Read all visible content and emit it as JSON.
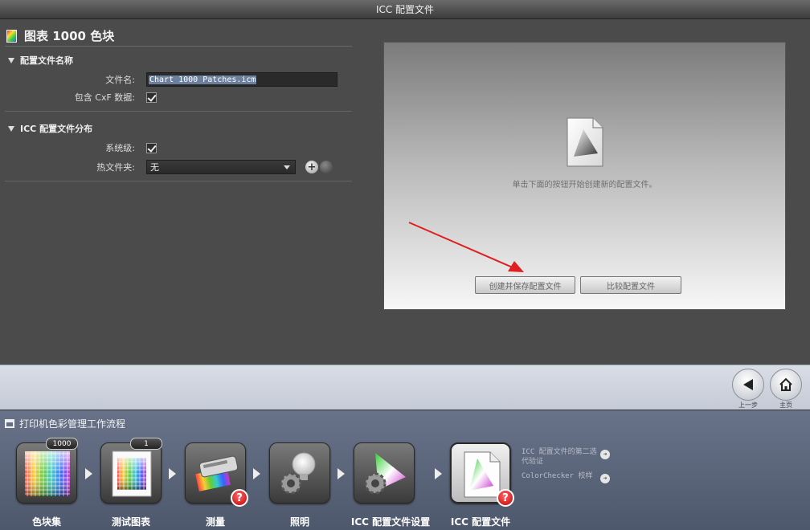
{
  "window": {
    "title": "ICC 配置文件"
  },
  "page": {
    "title": "图表 1000 色块"
  },
  "profile_name_section": {
    "heading": "配置文件名称",
    "filename_label": "文件名:",
    "filename_value": "Chart 1000 Patches.icm",
    "include_cxf_label": "包含 CxF 数据:",
    "include_cxf_checked": true
  },
  "distribution_section": {
    "heading": "ICC 配置文件分布",
    "system_level_label": "系统级:",
    "system_level_checked": true,
    "hot_folder_label": "热文件夹:",
    "hot_folder_value": "无",
    "add_icon": "plus-icon",
    "remove_icon": "minus-icon"
  },
  "preview": {
    "hint": "单击下面的按钮开始创建新的配置文件。",
    "create_button": "创建并保存配置文件",
    "compare_button": "比较配置文件"
  },
  "nav": {
    "back_label": "上一步",
    "home_label": "主页"
  },
  "workflow": {
    "title": "打印机色彩管理工作流程",
    "steps": [
      {
        "label": "色块集",
        "badge": "1000"
      },
      {
        "label": "测试图表",
        "badge": "1"
      },
      {
        "label": "测量",
        "warning": true
      },
      {
        "label": "照明"
      },
      {
        "label": "ICC 配置文件设置"
      },
      {
        "label": "ICC 配置文件",
        "warning": true,
        "active": true
      }
    ],
    "side_links": [
      "ICC 配置文件的第二选代验证",
      "ColorChecker 校样"
    ]
  },
  "colors": {
    "accent_red": "#e02020",
    "workflow_bg": "#5a6478",
    "panel_bg": "#4b4b4b"
  }
}
